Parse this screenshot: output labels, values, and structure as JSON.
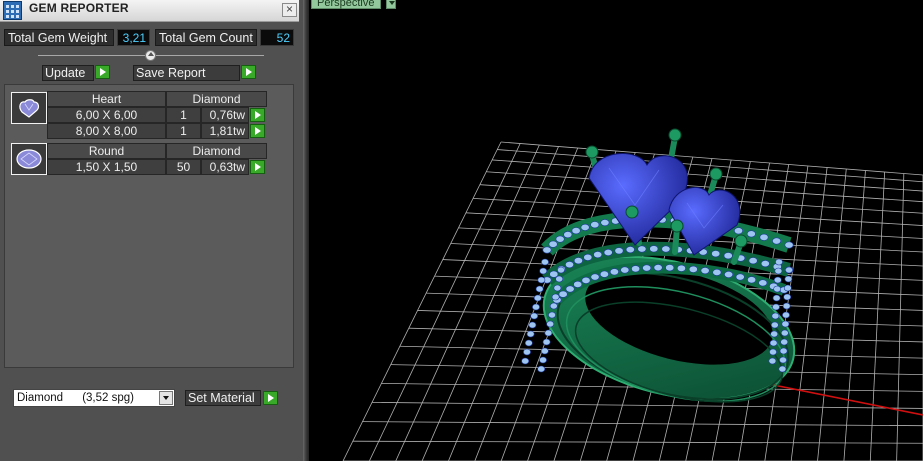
{
  "window": {
    "title": "GEM REPORTER",
    "icon": "gem-reporter-app-icon",
    "close_icon": "close-icon"
  },
  "stats": {
    "weight_label": "Total Gem Weight",
    "weight_value": "3,21",
    "count_label": "Total Gem Count",
    "count_value": "52"
  },
  "buttons": {
    "update": "Update",
    "save_report": "Save Report",
    "set_material": "Set Material"
  },
  "gems": [
    {
      "thumb_icon": "heart-gem-icon",
      "shape": "Heart",
      "material": "Diamond",
      "rows": [
        {
          "size": "6,00 X 6,00",
          "count": "1",
          "weight": "0,76tw"
        },
        {
          "size": "8,00 X 8,00",
          "count": "1",
          "weight": "1,81tw"
        }
      ]
    },
    {
      "thumb_icon": "round-gem-icon",
      "shape": "Round",
      "material": "Diamond",
      "rows": [
        {
          "size": "1,50 X 1,50",
          "count": "50",
          "weight": "0,63tw"
        }
      ]
    }
  ],
  "material_select": {
    "value": "Diamond      (3,52 spg)"
  },
  "viewport": {
    "view_mode": "Perspective",
    "background": "#000000",
    "grid_color": "#d8d8d8",
    "axis_x_color": "#d01010",
    "axis_y_color": "#2aa6b8",
    "ring_color": "#0f6b45",
    "gem_color": "#2d3fd2",
    "pave_stone_color": "#9ec4f0"
  },
  "colors": {
    "panel_bg": "#505050",
    "value_text": "#4fd0ff",
    "go_button": "#38a928"
  }
}
